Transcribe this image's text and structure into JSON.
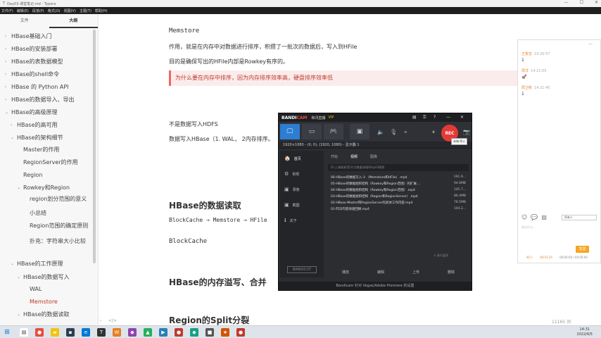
{
  "window": {
    "title": "Day03-课堂笔记.md - Typora"
  },
  "menubar": [
    "文件(F)",
    "编辑(E)",
    "段落(P)",
    "格式(O)",
    "视图(V)",
    "主题(T)",
    "帮助(H)"
  ],
  "sidebar": {
    "tabs": [
      "文件",
      "大纲"
    ],
    "active_tab": "大纲",
    "items": [
      {
        "label": "HBase基础入门",
        "indent": 0,
        "arrow": "›"
      },
      {
        "label": "HBase的安装部署",
        "indent": 0,
        "arrow": "›"
      },
      {
        "label": "HBase的表数据模型",
        "indent": 0,
        "arrow": "›"
      },
      {
        "label": "HBase的shell命令",
        "indent": 0,
        "arrow": "›"
      },
      {
        "label": "HBase 的 Python API",
        "indent": 0,
        "arrow": "›"
      },
      {
        "label": "HBase的数据导入、导出",
        "indent": 0,
        "arrow": "›"
      },
      {
        "label": "HBase的高级原理",
        "indent": 0,
        "arrow": "⌄"
      },
      {
        "label": "HBase的高可用",
        "indent": 1,
        "arrow": "›"
      },
      {
        "label": "HBase的架构细节",
        "indent": 1,
        "arrow": "⌄"
      },
      {
        "label": "Master的作用",
        "indent": 2,
        "arrow": ""
      },
      {
        "label": "RegionServer的作用",
        "indent": 2,
        "arrow": ""
      },
      {
        "label": "Region",
        "indent": 2,
        "arrow": ""
      },
      {
        "label": "Rowkey和Region",
        "indent": 2,
        "arrow": "⌄"
      },
      {
        "label": "region划分范围的意义",
        "indent": 3,
        "arrow": ""
      },
      {
        "label": "小总结",
        "indent": 3,
        "arrow": ""
      },
      {
        "label": "Region范围的确定原则",
        "indent": 3,
        "arrow": ""
      },
      {
        "label": "扑充：字符串大小比较",
        "indent": 3,
        "arrow": ""
      },
      {
        "label": "HBase的工作原理",
        "indent": 1,
        "arrow": "⌄"
      },
      {
        "label": "HBase的数据写入",
        "indent": 2,
        "arrow": "⌄"
      },
      {
        "label": "WAL",
        "indent": 3,
        "arrow": ""
      },
      {
        "label": "Memstore",
        "indent": 3,
        "arrow": "",
        "active": true
      },
      {
        "label": "HBase的数据读取",
        "indent": 2,
        "arrow": "⌄"
      }
    ],
    "footer_icons": [
      "‹",
      "</>"
    ]
  },
  "doc": {
    "memstore_heading": "Memstore",
    "para1": "作用，就是在内存中对数据进行排序，积攒了一批次的数据后，写入到HFile",
    "para2": "目的是确保写出的HFile内部是Rowkey有序的。",
    "quote": "为什么要在内存中排序，因为内存排序效率高，硬盘排序效率低",
    "para3": "不是数据写入HDFS",
    "para4": "数据写入HBase（1. WAL， 2内存排序。",
    "h_read": "HBase的数据读取",
    "read_flow": "BlockCache → Memstore → HFile",
    "blockcache": "BlockCache",
    "h_overflow": "HBase的内存溢写、合并",
    "h_split": "Region的Split分裂",
    "word_count": "11165 词"
  },
  "bandicam": {
    "brand": "BANDI",
    "brand_red": "CAM",
    "top_labels": [
      "和讯直播",
      "VIP"
    ],
    "rec_label": "REC",
    "tooltip": "录制/停止",
    "resolution": "1920×1080 - (0, 0), (1920, 1080) - 显示器 1",
    "side_items": [
      {
        "icon": "🏠",
        "label": "首页",
        "active": true
      },
      {
        "icon": "⚙",
        "label": "常规"
      },
      {
        "icon": "▣",
        "label": "录像"
      },
      {
        "icon": "▣",
        "label": "截图"
      },
      {
        "icon": "ℹ",
        "label": "关于"
      }
    ],
    "side_logo": "BANDICUT",
    "main_tabs": [
      "开始",
      "视频",
      "图像"
    ],
    "path": "D:\\上课录屏\\黑马\\大数据\\录屏\\Day03视频",
    "files": [
      {
        "name": "06-HBase的数据写入-1-（Memstore和HFile）.mp4",
        "size": "191.9..."
      },
      {
        "name": "05-HBase的数据组织结构（Rowkey和Region范围）的扩展....",
        "size": "94.6MB"
      },
      {
        "name": "04-HBase的数据组织结构（Rowkey和Region范围）.mp4",
        "size": "145.7..."
      },
      {
        "name": "03-HBase的数据组织结构（Region和RegionServer）.mp4",
        "size": "86.4MB"
      },
      {
        "name": "02-HBase-Master和RegionServer的具体工作内容.mp4",
        "size": "78.5MB"
      },
      {
        "name": "01-昨日内容快速回顾.mp4",
        "size": "104.2..."
      }
    ],
    "bottom_actions": [
      "播放",
      "编辑",
      "上传",
      "删除"
    ],
    "patrol": "⊙ 进行监测",
    "footer": "Bandicam 针对 Vegas/Adobe Premiere 的设置"
  },
  "chat": {
    "messages": [
      {
        "name": "王俊龙",
        "time": "14:20:57",
        "body": "1"
      },
      {
        "name": "周洋",
        "time": "14:21:05",
        "body": "🚀"
      },
      {
        "name": "周卫彬",
        "time": "14:21:40",
        "body": "1"
      }
    ],
    "target": "所有人",
    "input_placeholder": "说点什么...",
    "send": "发送",
    "stats": [
      "95人",
      "00:03:35",
      "00:00:00 / 00:00:00"
    ]
  },
  "taskbar": {
    "time": "14:31",
    "date": "2022/6/5"
  }
}
